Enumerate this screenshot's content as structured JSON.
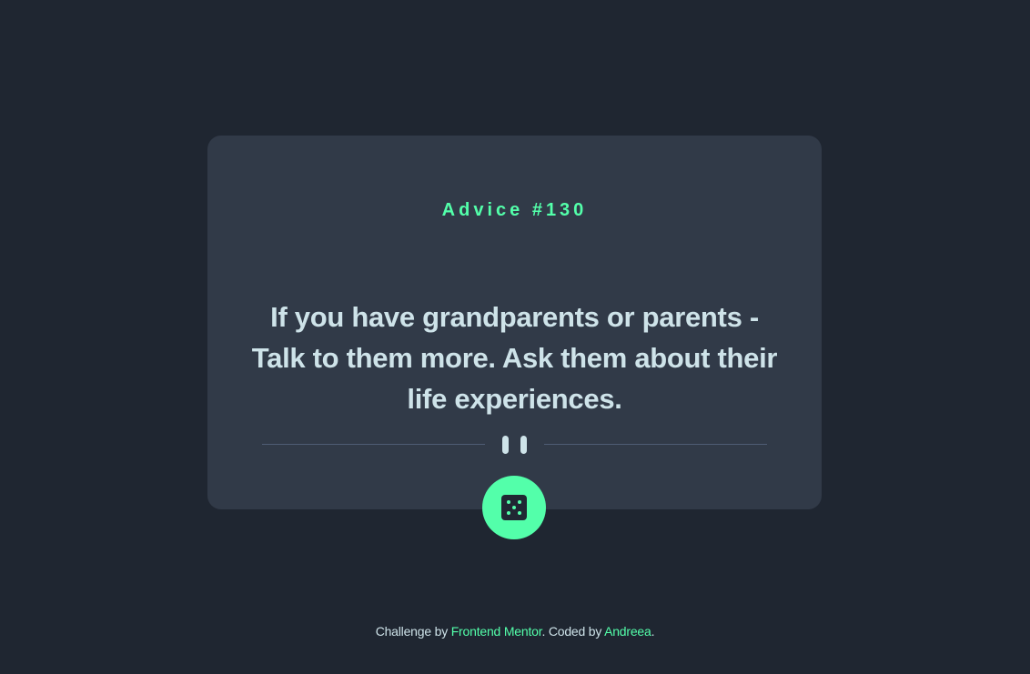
{
  "card": {
    "advice_label": "Advice #130",
    "advice_text": "If you have grandparents or parents - Talk to them more. Ask them about their life experiences."
  },
  "footer": {
    "prefix": "Challenge by ",
    "challenge_link": "Frontend Mentor",
    "middle": ". Coded by ",
    "author_link": "Andreea",
    "suffix": "."
  },
  "icons": {
    "divider": "pause-icon",
    "button": "dice-icon"
  },
  "colors": {
    "background": "#1f2631",
    "card": "#313a48",
    "accent": "#53ffaa",
    "text": "#cee3e9",
    "divider": "#4f5d74"
  }
}
